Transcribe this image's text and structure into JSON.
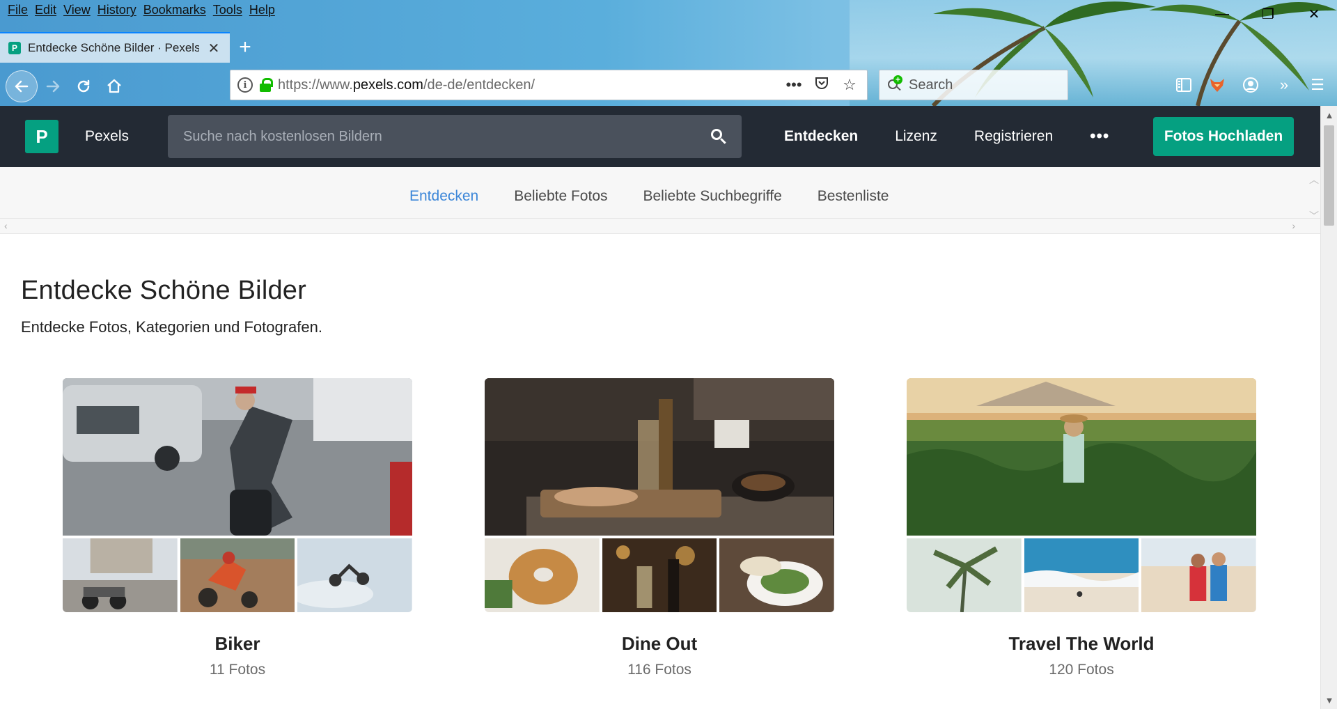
{
  "browser": {
    "menu": [
      "File",
      "Edit",
      "View",
      "History",
      "Bookmarks",
      "Tools",
      "Help"
    ],
    "tab_title": "Entdecke Schöne Bilder · Pexels",
    "url_prefix": "https://www.",
    "url_domain": "pexels.com",
    "url_path": "/de-de/entdecken/",
    "search_placeholder": "Search"
  },
  "header": {
    "brand": "Pexels",
    "logo_letter": "P",
    "search_placeholder": "Suche nach kostenlosen Bildern",
    "nav": [
      "Entdecken",
      "Lizenz",
      "Registrieren"
    ],
    "more": "•••",
    "upload_label": "Fotos Hochladen"
  },
  "subnav": {
    "tabs": [
      "Entdecken",
      "Beliebte Fotos",
      "Beliebte Suchbegriffe",
      "Bestenliste"
    ]
  },
  "main": {
    "title": "Entdecke Schöne Bilder",
    "subtitle": "Entdecke Fotos, Kategorien und Fotografen."
  },
  "collections": [
    {
      "name": "Biker",
      "count": "11 Fotos"
    },
    {
      "name": "Dine Out",
      "count": "116 Fotos"
    },
    {
      "name": "Travel The World",
      "count": "120 Fotos"
    }
  ],
  "colors": {
    "accent": "#05a081",
    "header_bg": "#232a34",
    "active_tab": "#3b86d8"
  }
}
